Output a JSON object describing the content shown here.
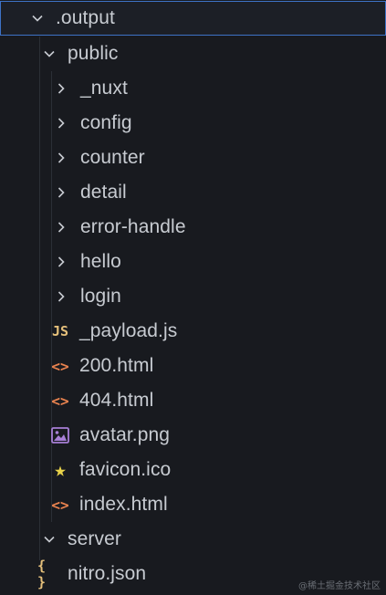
{
  "explorer": {
    "root": {
      "label": ".output",
      "expanded": true
    },
    "public": {
      "label": "public",
      "expanded": true
    },
    "public_folders": [
      {
        "label": "_nuxt",
        "icon": "chevron-right-icon"
      },
      {
        "label": "config",
        "icon": "chevron-right-icon"
      },
      {
        "label": "counter",
        "icon": "chevron-right-icon"
      },
      {
        "label": "detail",
        "icon": "chevron-right-icon"
      },
      {
        "label": "error-handle",
        "icon": "chevron-right-icon"
      },
      {
        "label": "hello",
        "icon": "chevron-right-icon"
      },
      {
        "label": "login",
        "icon": "chevron-right-icon"
      }
    ],
    "public_files": [
      {
        "label": "_payload.js",
        "icon": "js-file-icon",
        "glyph": "JS",
        "color": "#e5c07b"
      },
      {
        "label": "200.html",
        "icon": "html-file-icon",
        "glyph": "<>",
        "color": "#e8824f"
      },
      {
        "label": "404.html",
        "icon": "html-file-icon",
        "glyph": "<>",
        "color": "#e8824f"
      },
      {
        "label": "avatar.png",
        "icon": "image-file-icon",
        "glyph": "",
        "color": "#a77fd6"
      },
      {
        "label": "favicon.ico",
        "icon": "star-icon",
        "glyph": "★",
        "color": "#e9d34a"
      },
      {
        "label": "index.html",
        "icon": "html-file-icon",
        "glyph": "<>",
        "color": "#e8824f"
      }
    ],
    "server": {
      "label": "server",
      "expanded": true
    },
    "server_files": [
      {
        "label": "nitro.json",
        "icon": "json-file-icon",
        "glyph": "{ }",
        "color": "#e5c07b"
      }
    ]
  },
  "watermark": "@稀土掘金技术社区",
  "colors": {
    "background": "#181a1f",
    "text": "#c7cbd1",
    "selection_border": "#3d72c6",
    "chevron": "#c7cbd1"
  }
}
